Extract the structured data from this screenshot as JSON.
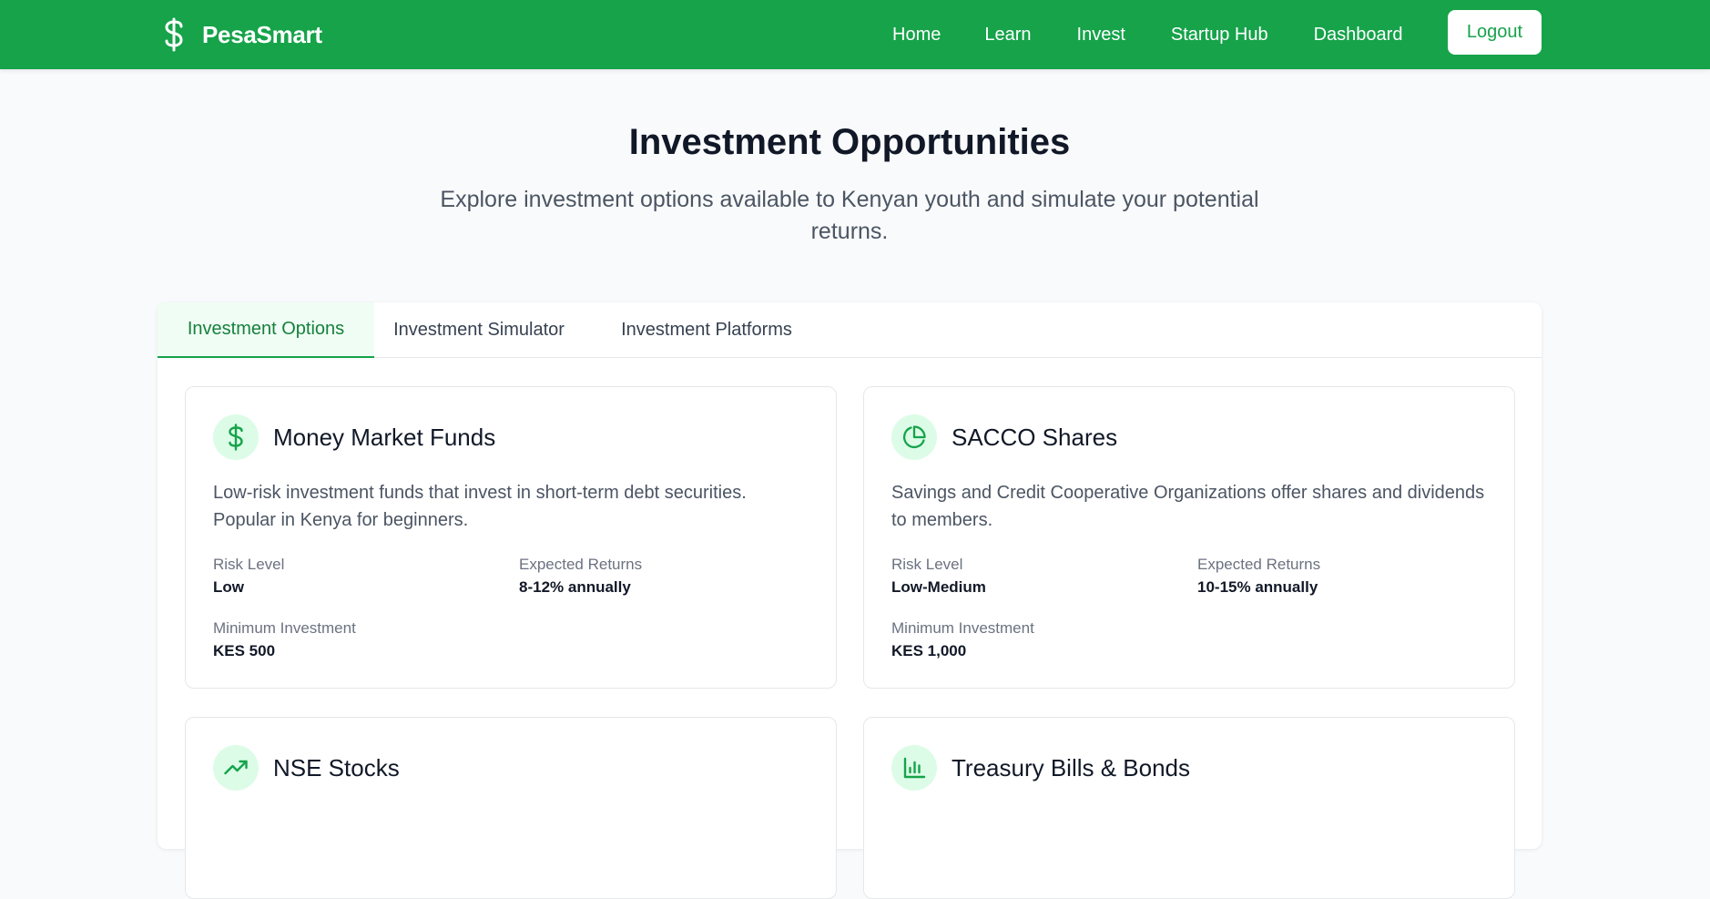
{
  "nav": {
    "brand": "PesaSmart",
    "links": [
      "Home",
      "Learn",
      "Invest",
      "Startup Hub",
      "Dashboard"
    ],
    "logout": "Logout"
  },
  "hero": {
    "title": "Investment Opportunities",
    "subtitle": "Explore investment options available to Kenyan youth and simulate your potential returns."
  },
  "tabs": [
    "Investment Options",
    "Investment Simulator",
    "Investment Platforms"
  ],
  "labels": {
    "risk": "Risk Level",
    "returns": "Expected Returns",
    "min": "Minimum Investment"
  },
  "cards": [
    {
      "icon": "dollar-icon",
      "title": "Money Market Funds",
      "description": "Low-risk investment funds that invest in short-term debt securities. Popular in Kenya for beginners.",
      "risk": "Low",
      "returns": "8-12% annually",
      "minimum": "KES 500"
    },
    {
      "icon": "pie-chart-icon",
      "title": "SACCO Shares",
      "description": "Savings and Credit Cooperative Organizations offer shares and dividends to members.",
      "risk": "Low-Medium",
      "returns": "10-15% annually",
      "minimum": "KES 1,000"
    },
    {
      "icon": "trending-up-icon",
      "title": "NSE Stocks"
    },
    {
      "icon": "bar-chart-icon",
      "title": "Treasury Bills & Bonds"
    }
  ],
  "colors": {
    "brand": "#16a34a",
    "brand_dark": "#15803d",
    "icon_bg": "#dcfce7"
  }
}
